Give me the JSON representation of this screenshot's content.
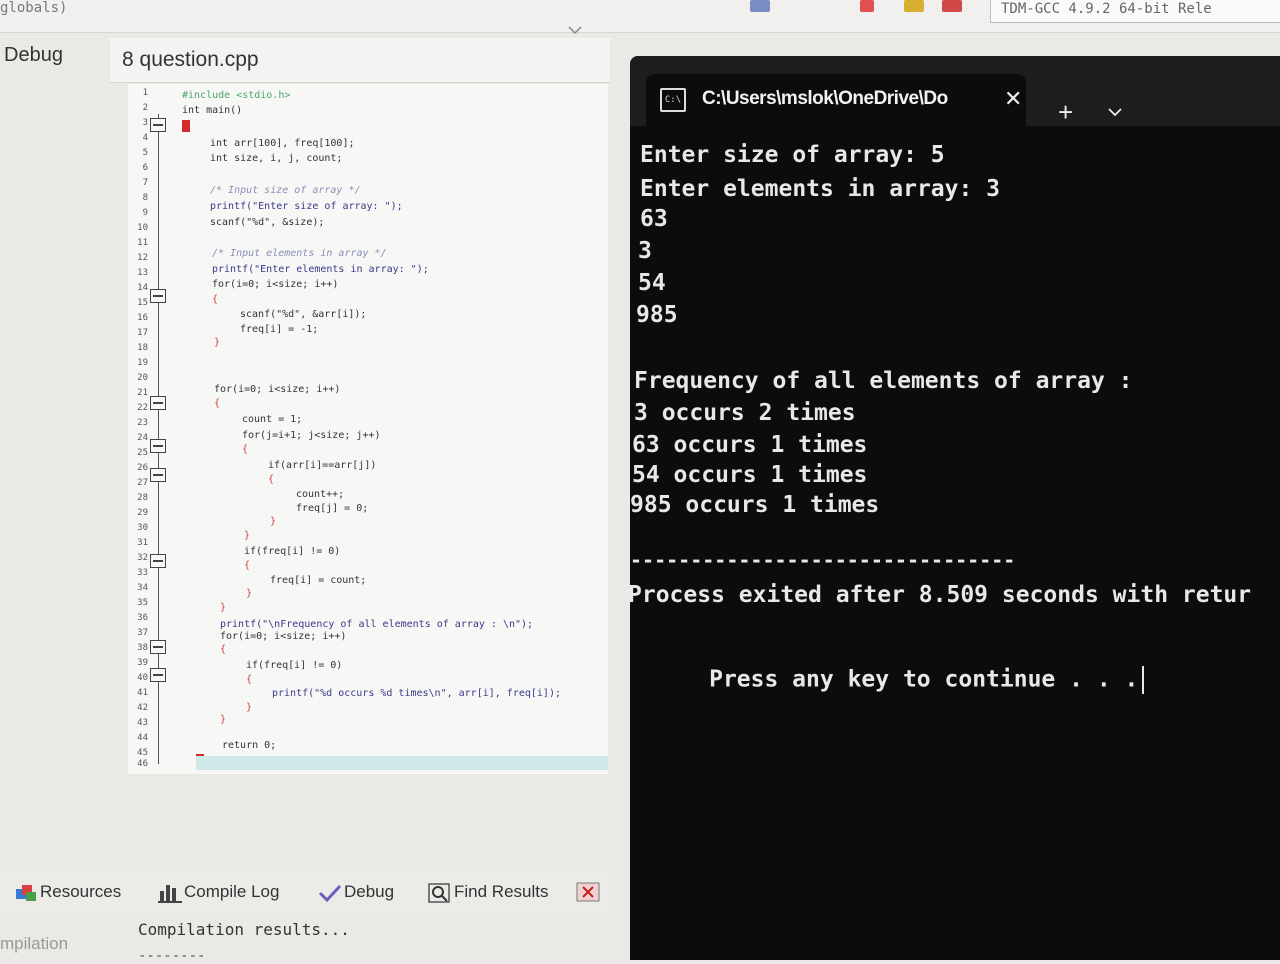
{
  "ide": {
    "scope_text": "globals)",
    "compiler": "TDM-GCC 4.9.2 64-bit Rele",
    "side_tab": "Debug",
    "file_tab": "8 question.cpp",
    "line_numbers": [
      "1",
      "2",
      "3",
      "4",
      "5",
      "6",
      "7",
      "8",
      "9",
      "10",
      "11",
      "12",
      "13",
      "14",
      "15",
      "16",
      "17",
      "18",
      "19",
      "20",
      "21",
      "22",
      "23",
      "24",
      "25",
      "26",
      "27",
      "28",
      "29",
      "30",
      "31",
      "32",
      "33",
      "34",
      "35",
      "36",
      "37",
      "38",
      "39",
      "40",
      "41",
      "42",
      "43",
      "44",
      "45",
      "46"
    ],
    "code": {
      "l1": "#include <stdio.h>",
      "l2": "int main()",
      "l3": "{",
      "l4": "int arr[100], freq[100];",
      "l5": "int size, i, j, count;",
      "l7": "/* Input size of array */",
      "l8": "printf(\"Enter size of array: \");",
      "l9": "scanf(\"%d\", &size);",
      "l11": "/* Input elements in array */",
      "l12": "printf(\"Enter elements in array: \");",
      "l13": "for(i=0; i<size; i++)",
      "l14": "{",
      "l15": "scanf(\"%d\", &arr[i]);",
      "l16": "freq[i] = -1;",
      "l17": "}",
      "l20": "for(i=0; i<size; i++)",
      "l21": "{",
      "l22": "count = 1;",
      "l23": "for(j=i+1; j<size; j++)",
      "l24": "{",
      "l25": "if(arr[i]==arr[j])",
      "l26": "{",
      "l27": "count++;",
      "l28": "freq[j] = 0;",
      "l29": "}",
      "l30": "}",
      "l31": "if(freq[i] != 0)",
      "l32": "{",
      "l33": "freq[i] = count;",
      "l34": "}",
      "l35": "}",
      "l36": "printf(\"\\nFrequency of all elements of array : \\n\");",
      "l37": "for(i=0; i<size; i++)",
      "l38": "{",
      "l39": "if(freq[i] != 0)",
      "l40": "{",
      "l41": "printf(\"%d occurs %d times\\n\", arr[i], freq[i]);",
      "l42": "}",
      "l43": "}",
      "l45": "return 0;",
      "l46": "}"
    },
    "bottom_tabs": {
      "resources": "Resources",
      "compile_log": "Compile Log",
      "debug": "Debug",
      "find_results": "Find Results"
    },
    "compilation_title": "mpilation",
    "compilation_results": "Compilation results...",
    "compilation_dash": "--------"
  },
  "terminal": {
    "tab_title": "C:\\Users\\mslok\\OneDrive\\Do",
    "tab_icon_text": "C:\\",
    "close_glyph": "✕",
    "new_tab_glyph": "+",
    "chevron_glyph": "⌄",
    "lines": {
      "l1": "Enter size of array: 5",
      "l2": "Enter elements in array: 3",
      "l3": "63",
      "l4": "3",
      "l5": "54",
      "l6": "985",
      "l7": "Frequency of all elements of array :",
      "l8": "3 occurs 2 times",
      "l9": "63 occurs 1 times",
      "l10": "54 occurs 1 times",
      "l11": "985 occurs 1 times",
      "l12": "--------------------------------",
      "l13": "Process exited after 8.509 seconds with retur",
      "l14": "Press any key to continue . . ."
    }
  },
  "colors": {
    "terminal_bg": "#0c0c0c",
    "terminal_text": "#e8e8e8",
    "editor_bg": "#f7f7f5",
    "breakpoint": "#d32b2b"
  }
}
